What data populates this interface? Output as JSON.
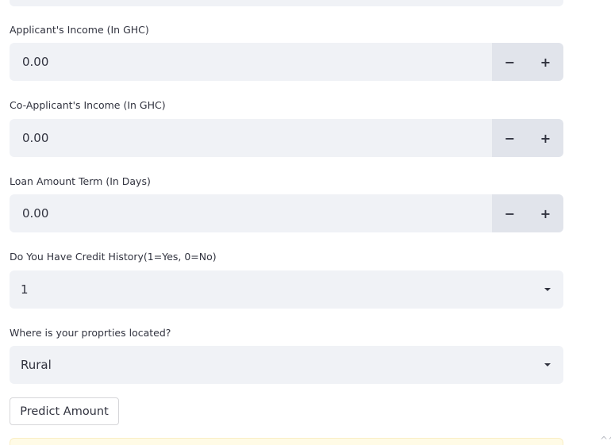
{
  "fields": {
    "applicant_income": {
      "label": "Applicant's Income (In GHC)",
      "value": "0.00",
      "minus": "−",
      "plus": "+"
    },
    "coapplicant_income": {
      "label": "Co-Applicant's Income (In GHC)",
      "value": "0.00",
      "minus": "−",
      "plus": "+"
    },
    "loan_term": {
      "label": "Loan Amount Term (In Days)",
      "value": "0.00",
      "minus": "−",
      "plus": "+"
    },
    "credit_history": {
      "label": "Do You Have Credit History(1=Yes, 0=No)",
      "selected": "1"
    },
    "property_area": {
      "label": "Where is your proprties located?",
      "selected": "Rural"
    }
  },
  "actions": {
    "predict_label": "Predict Amount"
  },
  "corner": {
    "text": "^^"
  },
  "colors": {
    "input_bg": "#f0f2f6",
    "stepper_bg": "#e1e4eb",
    "text": "#31333f",
    "alert_bg": "#fffbe6"
  },
  "icons": {
    "select_arrow": "chevron-down-icon"
  }
}
